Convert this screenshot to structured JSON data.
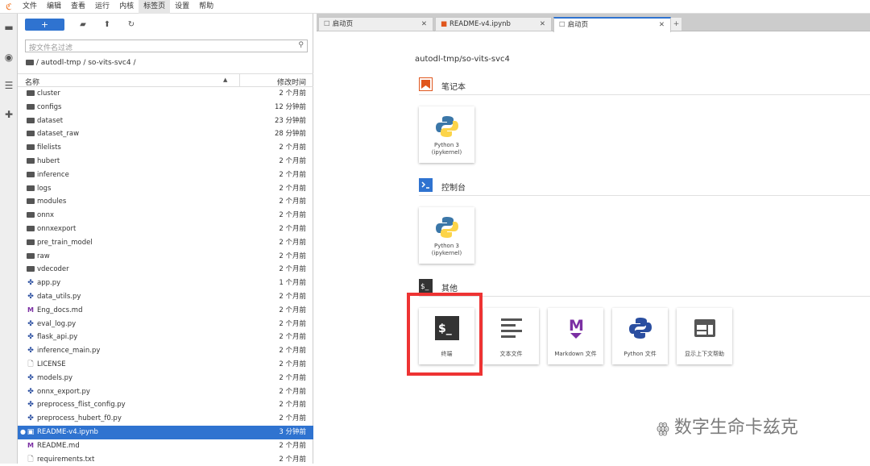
{
  "menubar": {
    "items": [
      "文件",
      "编辑",
      "查看",
      "运行",
      "内核",
      "标签页",
      "设置",
      "帮助"
    ],
    "active": "标签页"
  },
  "filebrowser": {
    "new_label": "+",
    "filter_placeholder": "按文件名过滤",
    "breadcrumb": "/ autodl-tmp / so-vits-svc4 /",
    "col_name": "名称",
    "col_modified": "修改时间",
    "files": [
      {
        "name": "cluster",
        "type": "folder",
        "modified": "2 个月前"
      },
      {
        "name": "configs",
        "type": "folder",
        "modified": "12 分钟前"
      },
      {
        "name": "dataset",
        "type": "folder",
        "modified": "23 分钟前"
      },
      {
        "name": "dataset_raw",
        "type": "folder",
        "modified": "28 分钟前"
      },
      {
        "name": "filelists",
        "type": "folder",
        "modified": "2 个月前"
      },
      {
        "name": "hubert",
        "type": "folder",
        "modified": "2 个月前"
      },
      {
        "name": "inference",
        "type": "folder",
        "modified": "2 个月前"
      },
      {
        "name": "logs",
        "type": "folder",
        "modified": "2 个月前"
      },
      {
        "name": "modules",
        "type": "folder",
        "modified": "2 个月前"
      },
      {
        "name": "onnx",
        "type": "folder",
        "modified": "2 个月前"
      },
      {
        "name": "onnxexport",
        "type": "folder",
        "modified": "2 个月前"
      },
      {
        "name": "pre_train_model",
        "type": "folder",
        "modified": "2 个月前"
      },
      {
        "name": "raw",
        "type": "folder",
        "modified": "2 个月前"
      },
      {
        "name": "vdecoder",
        "type": "folder",
        "modified": "2 个月前"
      },
      {
        "name": "app.py",
        "type": "python",
        "modified": "1 个月前"
      },
      {
        "name": "data_utils.py",
        "type": "python",
        "modified": "2 个月前"
      },
      {
        "name": "Eng_docs.md",
        "type": "markdown",
        "modified": "2 个月前"
      },
      {
        "name": "eval_log.py",
        "type": "python",
        "modified": "2 个月前"
      },
      {
        "name": "flask_api.py",
        "type": "python",
        "modified": "2 个月前"
      },
      {
        "name": "inference_main.py",
        "type": "python",
        "modified": "2 个月前"
      },
      {
        "name": "LICENSE",
        "type": "file",
        "modified": "2 个月前"
      },
      {
        "name": "models.py",
        "type": "python",
        "modified": "2 个月前"
      },
      {
        "name": "onnx_export.py",
        "type": "python",
        "modified": "2 个月前"
      },
      {
        "name": "preprocess_flist_config.py",
        "type": "python",
        "modified": "2 个月前"
      },
      {
        "name": "preprocess_hubert_f0.py",
        "type": "python",
        "modified": "2 个月前"
      },
      {
        "name": "README-v4.ipynb",
        "type": "notebook",
        "modified": "3 分钟前",
        "selected": true
      },
      {
        "name": "README.md",
        "type": "markdown",
        "modified": "2 个月前"
      },
      {
        "name": "requirements.txt",
        "type": "file",
        "modified": "2 个月前"
      }
    ]
  },
  "tabs": [
    {
      "label": "启动页"
    },
    {
      "label": "README-v4.ipynb"
    },
    {
      "label": "启动页",
      "active": true
    }
  ],
  "launcher": {
    "path": "autodl-tmp/so-vits-svc4",
    "notebook_section": "笔记本",
    "console_section": "控制台",
    "other_section": "其他",
    "kernel_label_1": "Python 3",
    "kernel_label_2": "(ipykernel)",
    "other_cards": [
      "终端",
      "文本文件",
      "Markdown 文件",
      "Python 文件",
      "显示上下文帮助"
    ]
  },
  "watermark": "数字生命卡兹克",
  "colors": {
    "accent": "#2f73d0",
    "notebook": "#e0571e",
    "highlight": "#ee3333",
    "markdown": "#7b2fa3"
  }
}
